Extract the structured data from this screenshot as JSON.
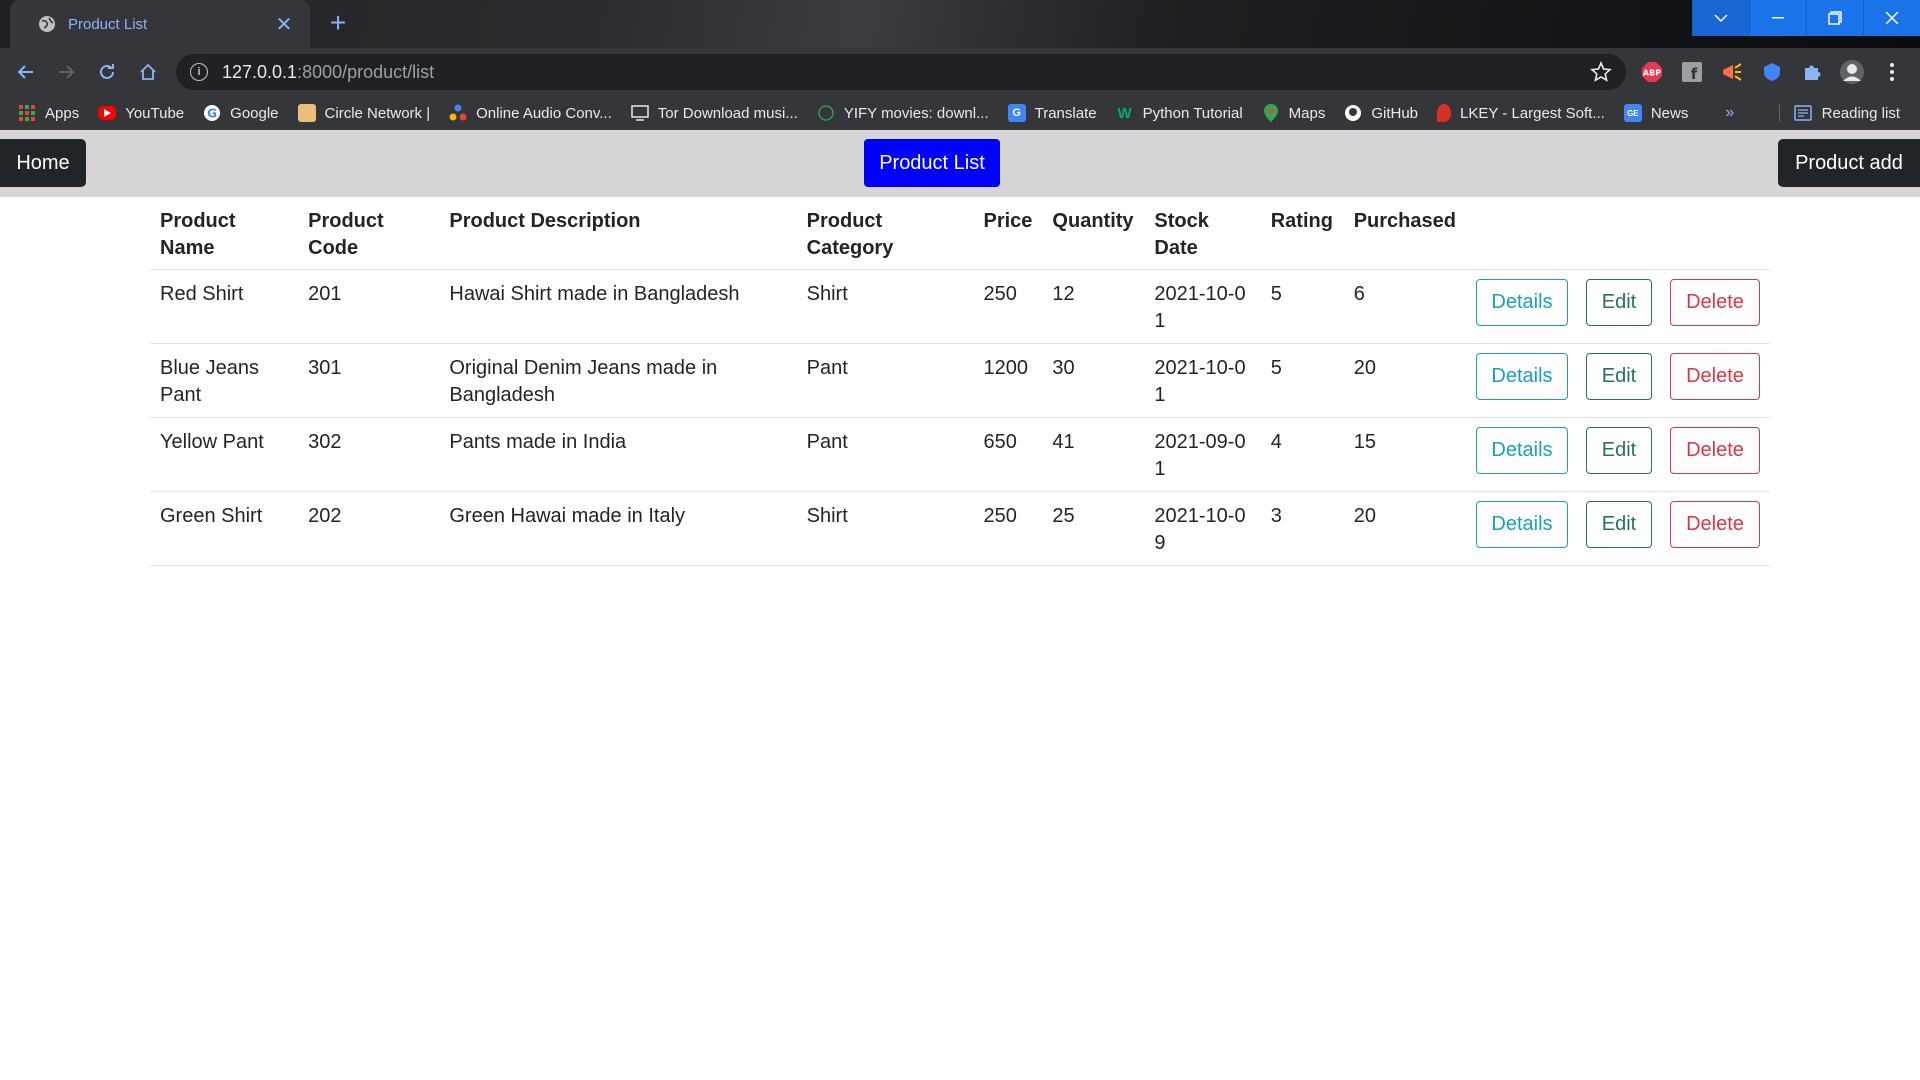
{
  "browser": {
    "tab_title": "Product List",
    "url_host": "127.0.0.1",
    "url_rest": ":8000/product/list",
    "bookmarks": [
      {
        "label": "Apps",
        "icon": "apps-grid-icon",
        "color": "#4285f4"
      },
      {
        "label": "YouTube",
        "icon": "youtube-icon",
        "color": "#ff0000"
      },
      {
        "label": "Google",
        "icon": "google-icon",
        "color": "#ffffff"
      },
      {
        "label": "Circle Network |",
        "icon": "circle-network-icon",
        "color": "#e8c07a"
      },
      {
        "label": "Online Audio Conv...",
        "icon": "audio-converter-icon",
        "color": "#fbbc04"
      },
      {
        "label": "Tor Download musi...",
        "icon": "tor-download-icon",
        "color": "#e8eaed"
      },
      {
        "label": "YIFY movies: downl...",
        "icon": "yify-icon",
        "color": "#34a853"
      },
      {
        "label": "Translate",
        "icon": "translate-icon",
        "color": "#4285f4"
      },
      {
        "label": "Python Tutorial",
        "icon": "w3schools-icon",
        "color": "#04aa6d"
      },
      {
        "label": "Maps",
        "icon": "maps-pin-icon",
        "color": "#ea4335"
      },
      {
        "label": "GitHub",
        "icon": "github-icon",
        "color": "#ffffff"
      },
      {
        "label": "LKEY - Largest Soft...",
        "icon": "lkey-icon",
        "color": "#d93025"
      },
      {
        "label": "News",
        "icon": "news-icon",
        "color": "#4285f4"
      }
    ],
    "bookmarks_more": "»",
    "reading_list": "Reading list"
  },
  "nav": {
    "home": "Home",
    "product_list": "Product List",
    "product_add": "Product add"
  },
  "table": {
    "headers": {
      "name": [
        "Product",
        "Name"
      ],
      "code": [
        "Product",
        "Code"
      ],
      "description": "Product Description",
      "category": [
        "Product",
        "Category"
      ],
      "price": "Price",
      "quantity": "Quantity",
      "stock_date": [
        "Stock",
        "Date"
      ],
      "rating": "Rating",
      "purchased": "Purchased"
    },
    "rows": [
      {
        "name": "Red Shirt",
        "code": "201",
        "description": "Hawai Shirt made in Bangladesh",
        "category": "Shirt",
        "price": "250",
        "quantity": "12",
        "stock_date": "2021-10-01",
        "rating": "5",
        "purchased": "6"
      },
      {
        "name": "Blue Jeans Pant",
        "code": "301",
        "description": "Original Denim Jeans made in Bangladesh",
        "category": "Pant",
        "price": "1200",
        "quantity": "30",
        "stock_date": "2021-10-01",
        "rating": "5",
        "purchased": "20"
      },
      {
        "name": "Yellow Pant",
        "code": "302",
        "description": "Pants made in India",
        "category": "Pant",
        "price": "650",
        "quantity": "41",
        "stock_date": "2021-09-01",
        "rating": "4",
        "purchased": "15"
      },
      {
        "name": "Green Shirt",
        "code": "202",
        "description": "Green Hawai made in Italy",
        "category": "Shirt",
        "price": "250",
        "quantity": "25",
        "stock_date": "2021-10-09",
        "rating": "3",
        "purchased": "20"
      }
    ],
    "actions": {
      "details": "Details",
      "edit": "Edit",
      "delete": "Delete"
    }
  },
  "colors": {
    "primary_nav": "#0000ff",
    "dark_button": "#212529",
    "details": "#17a2b8",
    "edit": "#28715c",
    "delete": "#dc3545"
  }
}
